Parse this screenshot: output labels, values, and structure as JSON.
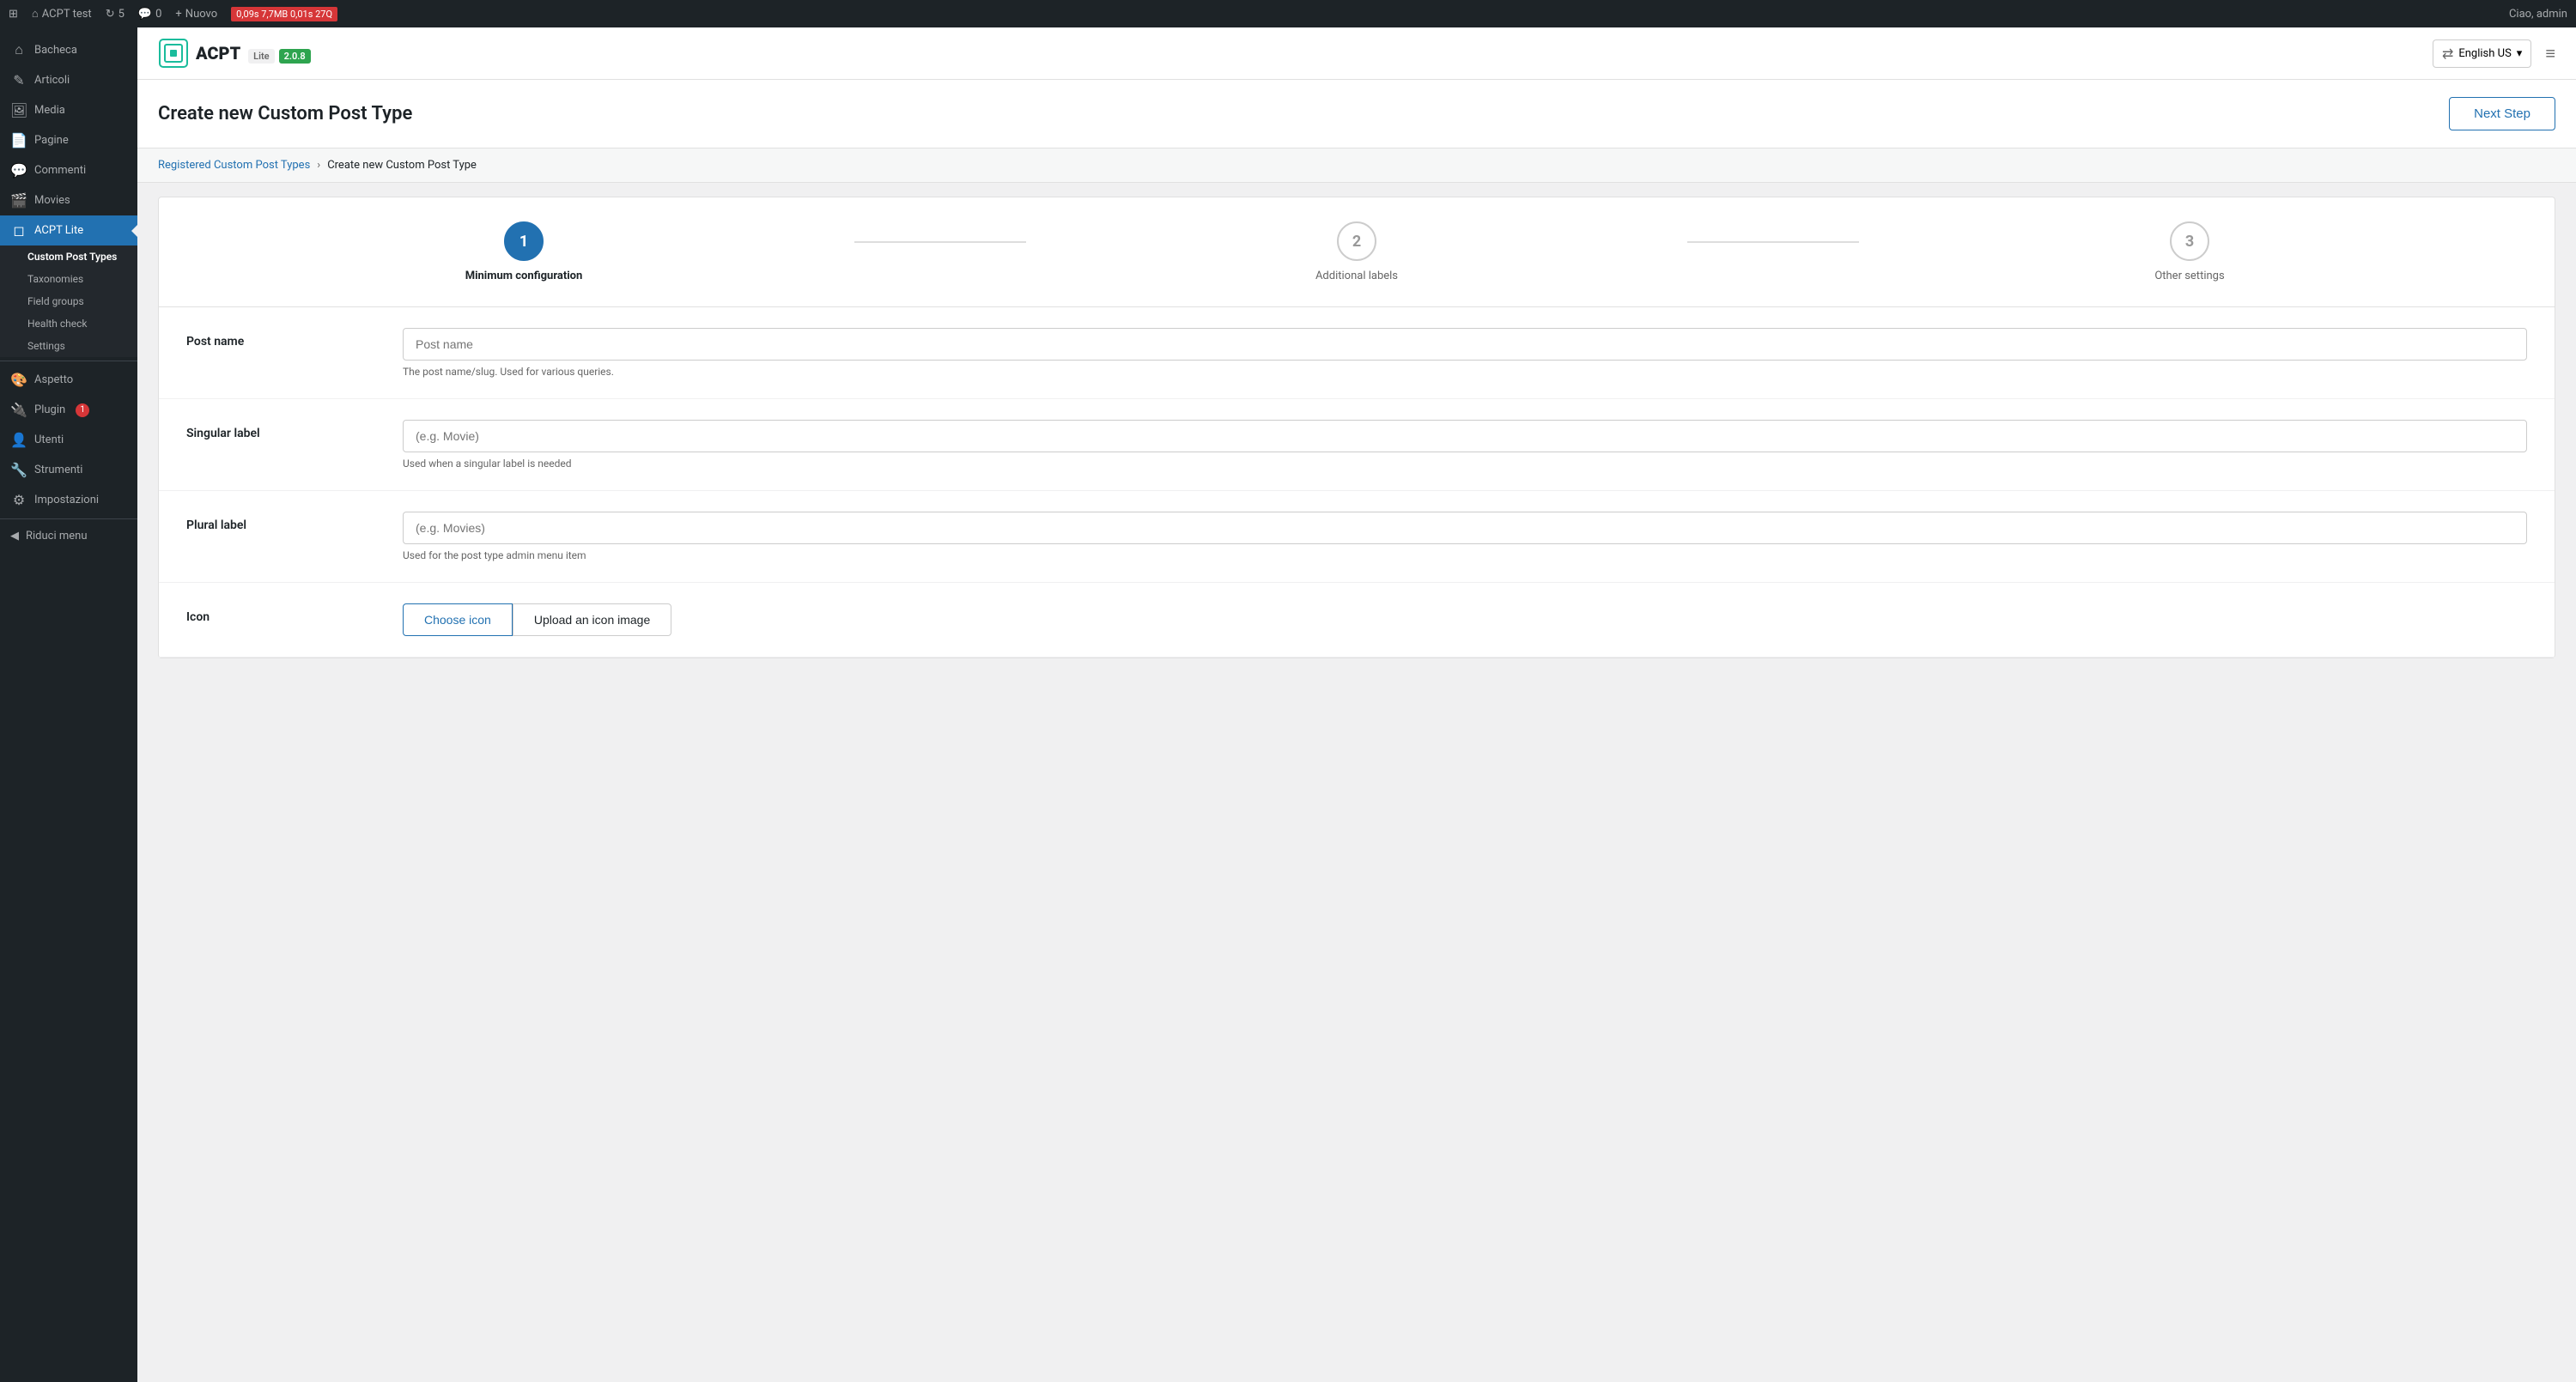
{
  "adminBar": {
    "siteName": "ACPT test",
    "commentCount": "0",
    "revisions": "5",
    "newLabel": "Nuovo",
    "metrics": "0,09s  7,7MB  0,01s  27Q",
    "userGreeting": "Ciao, admin"
  },
  "sidebar": {
    "items": [
      {
        "id": "bacheca",
        "label": "Bacheca",
        "icon": "⌂"
      },
      {
        "id": "articoli",
        "label": "Articoli",
        "icon": "✏"
      },
      {
        "id": "media",
        "label": "Media",
        "icon": "🖼"
      },
      {
        "id": "pagine",
        "label": "Pagine",
        "icon": "📄"
      },
      {
        "id": "commenti",
        "label": "Commenti",
        "icon": "💬"
      },
      {
        "id": "movies",
        "label": "Movies",
        "icon": "🎬"
      },
      {
        "id": "acpt-lite",
        "label": "ACPT Lite",
        "icon": "◻",
        "active": true
      }
    ],
    "submenu": [
      {
        "id": "custom-post-types",
        "label": "Custom Post Types",
        "active": true
      },
      {
        "id": "taxonomies",
        "label": "Taxonomies"
      },
      {
        "id": "field-groups",
        "label": "Field groups"
      },
      {
        "id": "health-check",
        "label": "Health check"
      },
      {
        "id": "settings",
        "label": "Settings"
      }
    ],
    "bottomItems": [
      {
        "id": "aspetto",
        "label": "Aspetto",
        "icon": "🎨"
      },
      {
        "id": "plugin",
        "label": "Plugin",
        "icon": "🔌",
        "badge": "1"
      },
      {
        "id": "utenti",
        "label": "Utenti",
        "icon": "👤"
      },
      {
        "id": "strumenti",
        "label": "Strumenti",
        "icon": "🔧"
      },
      {
        "id": "impostazioni",
        "label": "Impostazioni",
        "icon": "⚙"
      }
    ],
    "collapse": "Riduci menu"
  },
  "pluginHeader": {
    "logoText": "ACPT",
    "liteLabel": "Lite",
    "version": "2.0.8",
    "languageLabel": "English US",
    "translateIcon": "translate"
  },
  "pageHeader": {
    "title": "Create new Custom Post Type",
    "nextStepLabel": "Next Step"
  },
  "breadcrumb": {
    "parentLabel": "Registered Custom Post Types",
    "currentLabel": "Create new Custom Post Type"
  },
  "stepper": {
    "steps": [
      {
        "number": "1",
        "label": "Minimum configuration",
        "active": true
      },
      {
        "number": "2",
        "label": "Additional labels",
        "active": false
      },
      {
        "number": "3",
        "label": "Other settings",
        "active": false
      }
    ]
  },
  "form": {
    "fields": [
      {
        "id": "post-name",
        "label": "Post name",
        "placeholder": "Post name",
        "hint": "The post name/slug. Used for various queries.",
        "type": "text"
      },
      {
        "id": "singular-label",
        "label": "Singular label",
        "placeholder": "(e.g. Movie)",
        "hint": "Used when a singular label is needed",
        "type": "text"
      },
      {
        "id": "plural-label",
        "label": "Plural label",
        "placeholder": "(e.g. Movies)",
        "hint": "Used for the post type admin menu item",
        "type": "text"
      }
    ],
    "iconRow": {
      "label": "Icon",
      "chooseIconLabel": "Choose icon",
      "uploadIconLabel": "Upload an icon image"
    }
  }
}
